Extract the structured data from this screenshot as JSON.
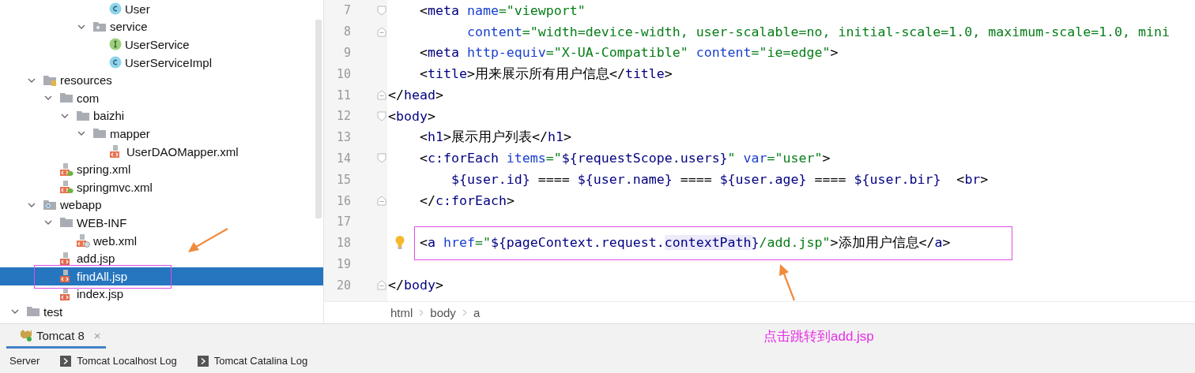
{
  "project_tree": [
    {
      "children": [
        {
          "children": [
            {
              "children": [
                {
                  "children": [
                    {
                      "children": [
                        {
                          "label": "User",
                          "kind": "class",
                          "selected": false
                        }
                      ]
                    },
                    {
                      "label": "service",
                      "kind": "package",
                      "expanded": true,
                      "selected": false,
                      "children": [
                        {
                          "label": "UserService",
                          "kind": "interface",
                          "selected": false
                        },
                        {
                          "label": "UserServiceImpl",
                          "kind": "class",
                          "selected": false
                        }
                      ]
                    }
                  ]
                }
              ]
            }
          ]
        },
        {
          "label": "resources",
          "kind": "resources-folder",
          "expanded": true,
          "selected": false,
          "children": [
            {
              "label": "com",
              "kind": "folder",
              "expanded": true,
              "selected": false,
              "children": [
                {
                  "label": "baizhi",
                  "kind": "folder",
                  "expanded": true,
                  "selected": false,
                  "children": [
                    {
                      "label": "mapper",
                      "kind": "folder",
                      "expanded": true,
                      "selected": false,
                      "children": [
                        {
                          "label": "UserDAOMapper.xml",
                          "kind": "xml",
                          "selected": false
                        }
                      ]
                    }
                  ]
                }
              ]
            },
            {
              "label": "spring.xml",
              "kind": "spring-xml",
              "selected": false
            },
            {
              "label": "springmvc.xml",
              "kind": "spring-xml",
              "selected": false
            }
          ]
        },
        {
          "label": "webapp",
          "kind": "web-folder",
          "expanded": true,
          "selected": false,
          "children": [
            {
              "label": "WEB-INF",
              "kind": "folder",
              "expanded": true,
              "selected": false,
              "children": [
                {
                  "label": "web.xml",
                  "kind": "web-xml",
                  "selected": false
                }
              ]
            },
            {
              "label": "add.jsp",
              "kind": "jsp",
              "selected": false
            },
            {
              "label": "findAll.jsp",
              "kind": "jsp",
              "selected": true
            },
            {
              "label": "index.jsp",
              "kind": "jsp",
              "selected": false
            }
          ]
        }
      ]
    },
    {
      "label": "test",
      "kind": "folder",
      "expanded": true,
      "selected": false
    }
  ],
  "editor": {
    "lines": [
      {
        "number": "7",
        "fold_open": true,
        "tokens": [
          {
            "text": "    <",
            "kind": "punct"
          },
          {
            "text": "meta",
            "kind": "tag"
          },
          {
            "text": " name",
            "kind": "attr"
          },
          {
            "text": "=\"viewport\"",
            "kind": "string"
          }
        ]
      },
      {
        "number": "8",
        "fold_close": true,
        "tokens": [
          {
            "text": "          content",
            "kind": "attr"
          },
          {
            "text": "=\"width=device-width, user-scalable=no, initial-scale=1.0, maximum-scale=1.0, mini",
            "kind": "string"
          }
        ]
      },
      {
        "number": "9",
        "tokens": [
          {
            "text": "    <",
            "kind": "punct"
          },
          {
            "text": "meta",
            "kind": "tag"
          },
          {
            "text": " http-equiv",
            "kind": "attr"
          },
          {
            "text": "=\"X-UA-Compatible\"",
            "kind": "string"
          },
          {
            "text": " content",
            "kind": "attr"
          },
          {
            "text": "=\"ie=edge\"",
            "kind": "string"
          },
          {
            "text": ">",
            "kind": "punct"
          }
        ]
      },
      {
        "number": "10",
        "tokens": [
          {
            "text": "    <",
            "kind": "punct"
          },
          {
            "text": "title",
            "kind": "tag"
          },
          {
            "text": ">用来展示所有用户信息</",
            "kind": "punct"
          },
          {
            "text": "title",
            "kind": "tag"
          },
          {
            "text": ">",
            "kind": "punct"
          }
        ]
      },
      {
        "number": "11",
        "fold_close": true,
        "tokens": [
          {
            "text": "</",
            "kind": "punct"
          },
          {
            "text": "head",
            "kind": "tag"
          },
          {
            "text": ">",
            "kind": "punct"
          }
        ]
      },
      {
        "number": "12",
        "fold_open": true,
        "tokens": [
          {
            "text": "<",
            "kind": "punct"
          },
          {
            "text": "body",
            "kind": "tag"
          },
          {
            "text": ">",
            "kind": "punct"
          }
        ]
      },
      {
        "number": "13",
        "tokens": [
          {
            "text": "    <",
            "kind": "punct"
          },
          {
            "text": "h1",
            "kind": "tag"
          },
          {
            "text": ">展示用户列表</",
            "kind": "punct"
          },
          {
            "text": "h1",
            "kind": "tag"
          },
          {
            "text": ">",
            "kind": "punct"
          }
        ]
      },
      {
        "number": "14",
        "fold_open": true,
        "tokens": [
          {
            "text": "    <",
            "kind": "punct"
          },
          {
            "text": "c:forEach",
            "kind": "tag"
          },
          {
            "text": " items",
            "kind": "attr"
          },
          {
            "text": "=\"",
            "kind": "string"
          },
          {
            "text": "${requestScope.users}",
            "kind": "expression"
          },
          {
            "text": "\"",
            "kind": "string"
          },
          {
            "text": " var",
            "kind": "attr"
          },
          {
            "text": "=\"user\"",
            "kind": "string"
          },
          {
            "text": ">",
            "kind": "punct"
          }
        ]
      },
      {
        "number": "15",
        "tokens": [
          {
            "text": "        ${user.id}",
            "kind": "expression"
          },
          {
            "text": " ==== ",
            "kind": "punct"
          },
          {
            "text": "${user.name}",
            "kind": "expression"
          },
          {
            "text": " ==== ",
            "kind": "punct"
          },
          {
            "text": "${user.age}",
            "kind": "expression"
          },
          {
            "text": " ==== ",
            "kind": "punct"
          },
          {
            "text": "${user.bir}",
            "kind": "expression"
          },
          {
            "text": "  <",
            "kind": "punct"
          },
          {
            "text": "br",
            "kind": "tag"
          },
          {
            "text": ">",
            "kind": "punct"
          }
        ]
      },
      {
        "number": "16",
        "fold_close": true,
        "tokens": [
          {
            "text": "    </",
            "kind": "punct"
          },
          {
            "text": "c:forEach",
            "kind": "tag"
          },
          {
            "text": ">",
            "kind": "punct"
          }
        ]
      },
      {
        "number": "17"
      },
      {
        "number": "18",
        "intention_bulb": true,
        "tokens": [
          {
            "text": "    <",
            "kind": "punct"
          },
          {
            "text": "a",
            "kind": "tag"
          },
          {
            "text": " href",
            "kind": "attr"
          },
          {
            "text": "=\"",
            "kind": "string"
          },
          {
            "text": "${pageContext.request.",
            "kind": "expression"
          },
          {
            "text": "contextPath",
            "kind": "highlighted"
          },
          {
            "text": "}",
            "kind": "expression"
          },
          {
            "text": "/add.jsp\"",
            "kind": "string"
          },
          {
            "text": ">添加用户信息</",
            "kind": "punct"
          },
          {
            "text": "a",
            "kind": "tag"
          },
          {
            "text": ">",
            "kind": "punct"
          }
        ]
      },
      {
        "number": "19"
      },
      {
        "number": "20",
        "fold_close": true,
        "tokens": [
          {
            "text": "</",
            "kind": "punct"
          },
          {
            "text": "body",
            "kind": "tag"
          },
          {
            "text": ">",
            "kind": "punct"
          }
        ]
      }
    ],
    "breadcrumbs": [
      "html",
      "body",
      "a"
    ]
  },
  "tool_window": {
    "tabs": [
      {
        "label": "Tomcat 8",
        "selected": true,
        "close": "×"
      }
    ],
    "annotation_text": "点击跳转到add.jsp",
    "sub_tabs": [
      {
        "label": "Server",
        "kind": "plain"
      },
      {
        "label": "Tomcat Localhost Log",
        "kind": "log"
      },
      {
        "label": "Tomcat Catalina Log",
        "kind": "log"
      }
    ]
  }
}
